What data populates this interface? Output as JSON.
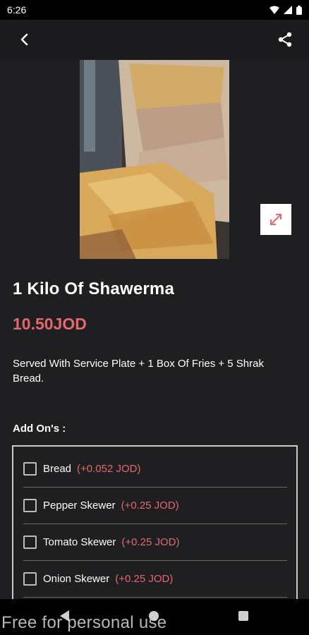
{
  "status_bar": {
    "time": "6:26",
    "icons": [
      "wifi-icon",
      "signal-icon",
      "battery-icon"
    ]
  },
  "app_bar": {
    "back_icon": "back-arrow-icon",
    "share_icon": "share-icon"
  },
  "product": {
    "image_alt": "shawerma-photo",
    "name": "1 Kilo Of Shawerma",
    "price": "10.50JOD",
    "description": "Served With Service Plate + 1 Box Of Fries + 5 Shrak Bread."
  },
  "addons": {
    "label": "Add On's :",
    "items": [
      {
        "name": "Bread",
        "price": "(+0.052 JOD)"
      },
      {
        "name": "Pepper Skewer",
        "price": "(+0.25 JOD)"
      },
      {
        "name": "Tomato Skewer",
        "price": "(+0.25 JOD)"
      },
      {
        "name": "Onion Skewer",
        "price": "(+0.25 JOD)"
      }
    ]
  },
  "watermark": "Free for personal use",
  "colors": {
    "background": "#1f1f22",
    "accent": "#e4686e",
    "text": "#ffffff"
  }
}
